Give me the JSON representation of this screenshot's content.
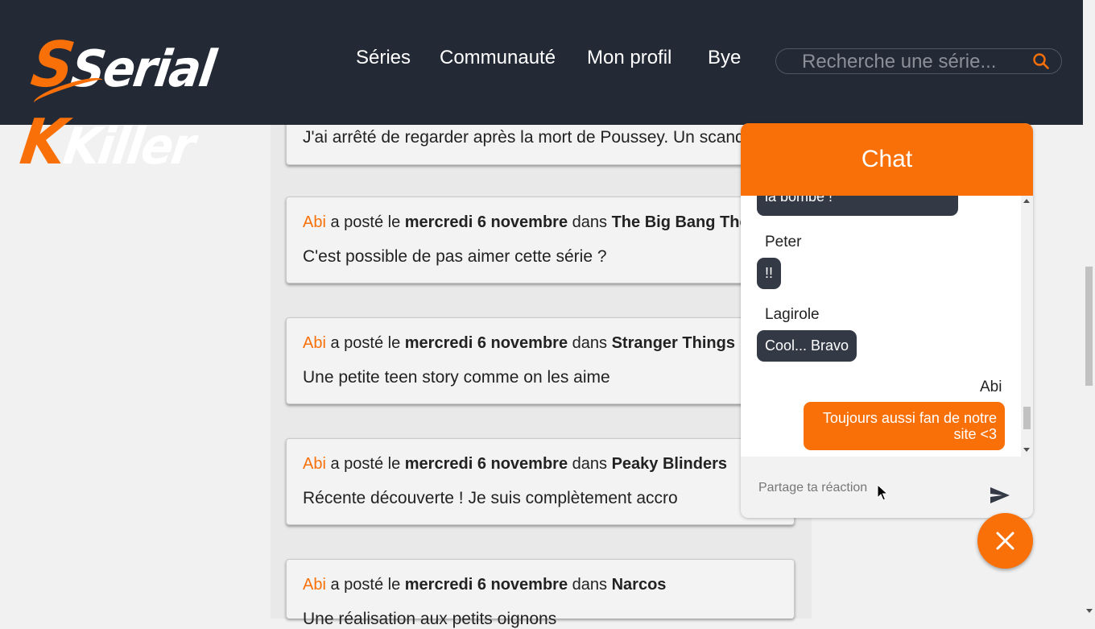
{
  "header": {
    "logo_text_1": "Serial ",
    "logo_text_2": "Killer",
    "nav": [
      "Séries",
      "Communauté",
      "Mon profil",
      "Bye"
    ],
    "search_placeholder": "Recherche une série..."
  },
  "posts": [
    {
      "text": "J'ai arrêté de regarder après la mort de Poussey. Un scand"
    },
    {
      "author": "Abi",
      "action": "a posté le",
      "date": "mercredi 6 novembre",
      "in": "dans",
      "series": "The Big Bang Theory",
      "text": "C'est possible de pas aimer cette série ?"
    },
    {
      "author": "Abi",
      "action": "a posté le",
      "date": "mercredi 6 novembre",
      "in": "dans",
      "series": "Stranger Things",
      "text": "Une petite teen story comme on les aime"
    },
    {
      "author": "Abi",
      "action": "a posté le",
      "date": "mercredi 6 novembre",
      "in": "dans",
      "series": "Peaky Blinders",
      "text": "Récente découverte ! Je suis complètement accro"
    },
    {
      "author": "Abi",
      "action": "a posté le",
      "date": "mercredi 6 novembre",
      "in": "dans",
      "series": "Narcos",
      "text": "Une réalisation aux petits oignons"
    }
  ],
  "chat": {
    "title": "Chat",
    "messages": [
      {
        "text": "la bombe !"
      },
      {
        "sender": "Peter",
        "text": "!!"
      },
      {
        "sender": "Lagirole",
        "text": "Cool... Bravo"
      },
      {
        "sender": "Abi",
        "text": "Toujours aussi fan de notre site <3"
      }
    ],
    "input_placeholder": "Partage ta réaction"
  },
  "colors": {
    "accent": "#f97008",
    "header_bg": "#232a36",
    "bubble_dark": "#333a45"
  }
}
